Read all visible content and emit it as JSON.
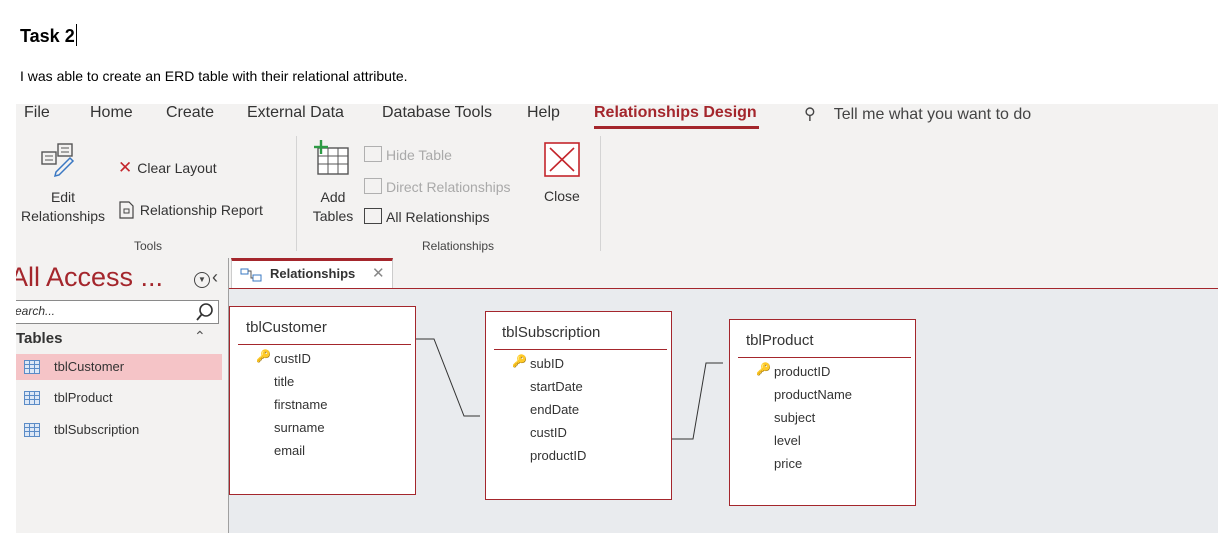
{
  "document": {
    "heading": "Task 2",
    "description": "I was able to create an ERD table with their relational attribute."
  },
  "menu": {
    "tabs": [
      "File",
      "Home",
      "Create",
      "External Data",
      "Database Tools",
      "Help",
      "Relationships Design"
    ],
    "tell_me": "Tell me what you want to do"
  },
  "ribbon": {
    "edit_relationships": [
      "Edit",
      "Relationships"
    ],
    "clear_layout": "Clear Layout",
    "relationship_report": "Relationship Report",
    "tools_group": "Tools",
    "add_tables": [
      "Add",
      "Tables"
    ],
    "hide_table": "Hide Table",
    "direct_relationships": "Direct Relationships",
    "all_relationships": "All Relationships",
    "close": "Close",
    "relationships_group": "Relationships"
  },
  "nav": {
    "title": "All Access ...",
    "search_placeholder": "earch...",
    "section": "Tables",
    "items": [
      "tblCustomer",
      "tblProduct",
      "tblSubscription"
    ],
    "selected": "tblCustomer"
  },
  "doc_tab": {
    "label": "Relationships"
  },
  "tables": [
    {
      "name": "tblCustomer",
      "fields": [
        "custID",
        "title",
        "firstname",
        "surname",
        "email"
      ],
      "key": "custID"
    },
    {
      "name": "tblSubscription",
      "fields": [
        "subID",
        "startDate",
        "endDate",
        "custID",
        "productID"
      ],
      "key": "subID"
    },
    {
      "name": "tblProduct",
      "fields": [
        "productID",
        "productName",
        "subject",
        "level",
        "price"
      ],
      "key": "productID"
    }
  ],
  "colors": {
    "accent": "#a4262c",
    "selected_bg": "#f5c4c7",
    "canvas_bg": "#e9ebee"
  }
}
